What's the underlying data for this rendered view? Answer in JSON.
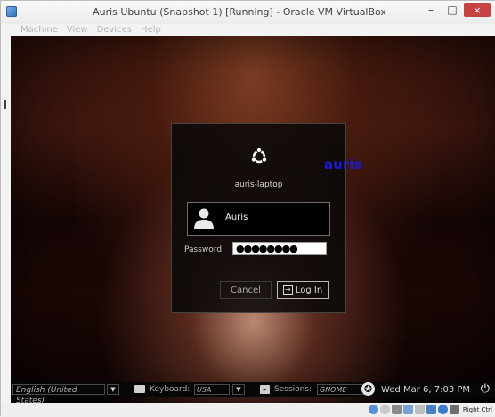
{
  "window": {
    "title": "Auris Ubuntu (Snapshot 1) [Running] - Oracle VM VirtualBox",
    "controls": {
      "minimize": "–",
      "maximize": "□",
      "close": "×"
    }
  },
  "menubar": {
    "items": [
      "Machine",
      "View",
      "Devices",
      "Help"
    ]
  },
  "login": {
    "hostname": "auris-laptop",
    "user": {
      "name": "Auris",
      "avatar_icon": "user-avatar-icon"
    },
    "password_label": "Password:",
    "password_value": "●●●●●●●●",
    "cancel_label": "Cancel",
    "login_label": "Log In",
    "overlay_text": "auris"
  },
  "bottom_panel": {
    "language_value": "English (United States)",
    "keyboard_label": "Keyboard:",
    "keyboard_value": "USA",
    "sessions_label": "Sessions:",
    "sessions_value": "GNOME",
    "clock": "Wed Mar 6, 7:03 PM"
  },
  "statusbar": {
    "host_key": "Right Ctrl"
  },
  "colors": {
    "accent_overlay": "#1a1ac8",
    "vm_background": "#2a0e09"
  }
}
